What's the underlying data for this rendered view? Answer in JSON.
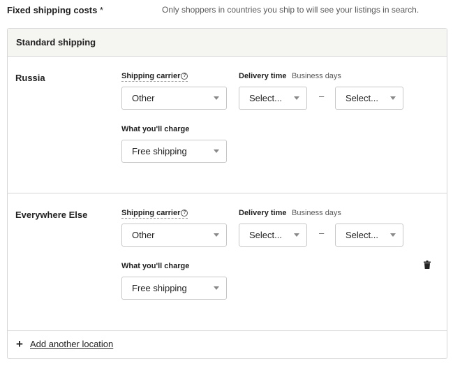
{
  "header": {
    "title": "Fixed shipping costs",
    "required_mark": "*",
    "note": "Only shoppers in countries you ship to will see your listings in search."
  },
  "panel": {
    "title": "Standard shipping",
    "locations": [
      {
        "name": "Russia",
        "carrier_label": "Shipping carrier",
        "carrier_value": "Other",
        "delivery_label": "Delivery time",
        "business_days": "Business days",
        "delivery_from": "Select...",
        "separator": "–",
        "delivery_to": "Select...",
        "charge_label": "What you'll charge",
        "charge_value": "Free shipping"
      },
      {
        "name": "Everywhere Else",
        "carrier_label": "Shipping carrier",
        "carrier_value": "Other",
        "delivery_label": "Delivery time",
        "business_days": "Business days",
        "delivery_from": "Select...",
        "separator": "–",
        "delivery_to": "Select...",
        "charge_label": "What you'll charge",
        "charge_value": "Free shipping"
      }
    ],
    "add_location": "Add another location"
  },
  "icons": {
    "help": "question-circle-icon",
    "dropdown": "caret-down-icon",
    "delete": "trash-icon",
    "add": "plus-icon"
  }
}
